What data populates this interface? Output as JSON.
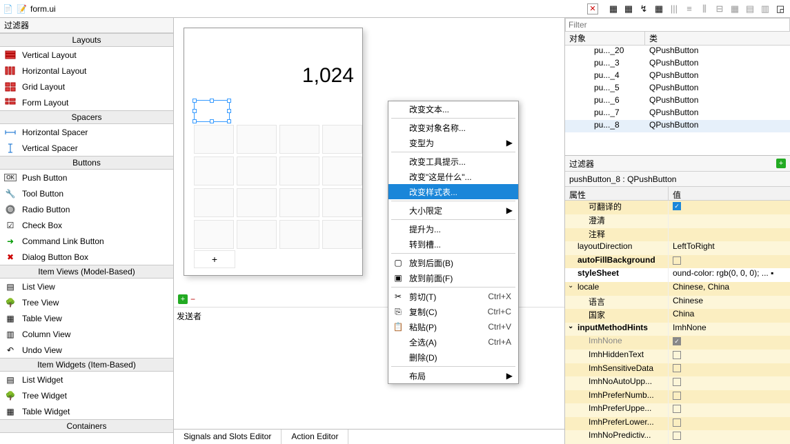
{
  "tab": {
    "filename": "form.ui"
  },
  "left": {
    "filter_label": "过滤器",
    "sections": {
      "layouts": "Layouts",
      "spacers": "Spacers",
      "buttons": "Buttons",
      "item_views": "Item Views (Model-Based)",
      "item_widgets": "Item Widgets (Item-Based)",
      "containers": "Containers"
    },
    "items": {
      "vertical_layout": "Vertical Layout",
      "horizontal_layout": "Horizontal Layout",
      "grid_layout": "Grid Layout",
      "form_layout": "Form Layout",
      "horizontal_spacer": "Horizontal Spacer",
      "vertical_spacer": "Vertical Spacer",
      "push_button": "Push Button",
      "tool_button": "Tool Button",
      "radio_button": "Radio Button",
      "check_box": "Check Box",
      "command_link_button": "Command Link Button",
      "dialog_button_box": "Dialog Button Box",
      "list_view": "List View",
      "tree_view": "Tree View",
      "table_view": "Table View",
      "column_view": "Column View",
      "undo_view": "Undo View",
      "list_widget": "List Widget",
      "tree_widget": "Tree Widget",
      "table_widget": "Table Widget"
    }
  },
  "canvas": {
    "display_value": "1,024"
  },
  "context_menu": {
    "change_text": "改变文本...",
    "change_obj_name": "改变对象名称...",
    "morph_into": "变型为",
    "change_tooltip": "改变工具提示...",
    "change_whatsthis": "改变\"这是什么\"...",
    "change_stylesheet": "改变样式表...",
    "size_constraints": "大小限定",
    "promote_to": "提升为...",
    "go_to_slot": "转到槽...",
    "send_to_back": "放到后面(B)",
    "bring_to_front": "放到前面(F)",
    "cut": "剪切(T)",
    "cut_sc": "Ctrl+X",
    "copy": "复制(C)",
    "copy_sc": "Ctrl+C",
    "paste": "粘贴(P)",
    "paste_sc": "Ctrl+V",
    "select_all": "全选(A)",
    "select_all_sc": "Ctrl+A",
    "delete": "删除(D)",
    "layout": "布局"
  },
  "signals": {
    "sender_label": "发送者",
    "tab_signals": "Signals and Slots Editor",
    "tab_action": "Action Editor"
  },
  "right": {
    "filter_placeholder": "Filter",
    "obj_col1": "对象",
    "obj_col2": "类",
    "rows": [
      {
        "name": "pu..._20",
        "cls": "QPushButton"
      },
      {
        "name": "pu..._3",
        "cls": "QPushButton"
      },
      {
        "name": "pu..._4",
        "cls": "QPushButton"
      },
      {
        "name": "pu..._5",
        "cls": "QPushButton"
      },
      {
        "name": "pu..._6",
        "cls": "QPushButton"
      },
      {
        "name": "pu..._7",
        "cls": "QPushButton"
      },
      {
        "name": "pu..._8",
        "cls": "QPushButton"
      }
    ],
    "prop_filter": "过滤器",
    "prop_object": "pushButton_8 : QPushButton",
    "prop_col1": "属性",
    "prop_col2": "值",
    "props": {
      "translatable": "可翻译的",
      "disambiguation": "澄清",
      "comment": "注释",
      "layoutDirection": "layoutDirection",
      "layoutDirection_v": "LeftToRight",
      "autoFillBackground": "autoFillBackground",
      "styleSheet": "styleSheet",
      "styleSheet_v": "ound-color: rgb(0, 0, 0); ...",
      "locale": "locale",
      "locale_v": "Chinese, China",
      "language": "语言",
      "language_v": "Chinese",
      "country": "国家",
      "country_v": "China",
      "inputMethodHints": "inputMethodHints",
      "inputMethodHints_v": "ImhNone",
      "ImhNone": "ImhNone",
      "ImhHiddenText": "ImhHiddenText",
      "ImhSensitiveData": "ImhSensitiveData",
      "ImhNoAutoUpp": "ImhNoAutoUpp...",
      "ImhPreferNumb": "ImhPreferNumb...",
      "ImhPreferUppe": "ImhPreferUppe...",
      "ImhPreferLower": "ImhPreferLower...",
      "ImhNoPredictiv": "ImhNoPredictiv..."
    }
  }
}
